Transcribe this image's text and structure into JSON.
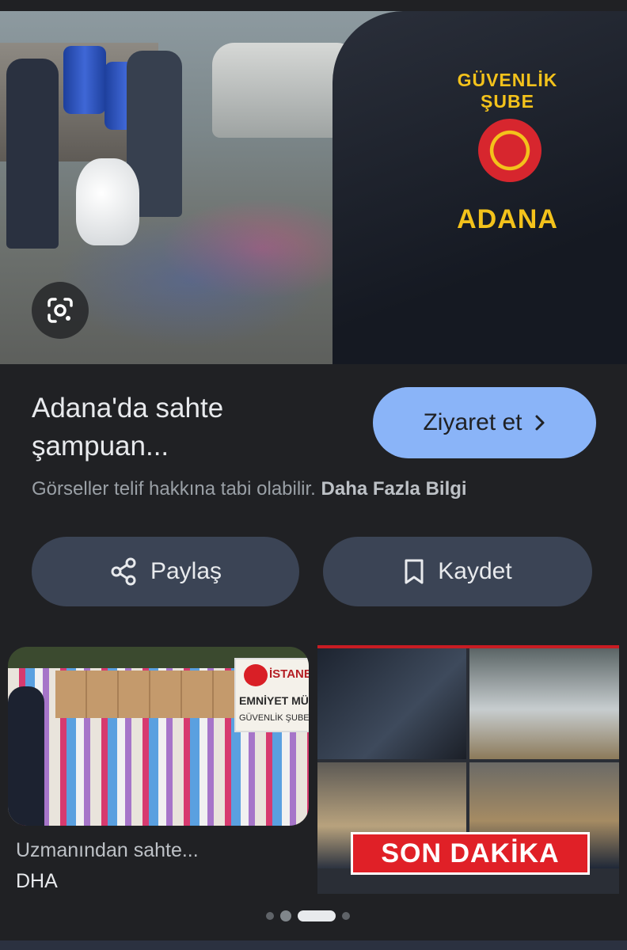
{
  "result": {
    "title": "Adana'da sahte şampuan...",
    "visit_label": "Ziyaret et",
    "copyright_text": "Görseller telif hakkına tabi olabilir.",
    "learn_more": "Daha Fazla Bilgi",
    "share_label": "Paylaş",
    "save_label": "Kaydet",
    "hero_badge": {
      "arc": "GÜVENLİK ŞUBE",
      "word": "ADANA"
    }
  },
  "related": [
    {
      "title": "Uzmanından sahte...",
      "source": "DHA",
      "sign": {
        "line1": "İSTANBUL",
        "line2": "EMNİYET MÜD",
        "line3": "GÜVENLİK ŞUBE MÜ"
      }
    },
    {
      "banner": "SON DAKİKA"
    }
  ],
  "carousel": {
    "count": 4,
    "active": 2
  },
  "colors": {
    "accent": "#8ab4f8",
    "background": "#202124",
    "button": "#3b4455",
    "banner_red": "#e02027"
  },
  "icons": [
    "google-lens-icon",
    "chevron-right-icon",
    "share-icon",
    "bookmark-icon"
  ]
}
